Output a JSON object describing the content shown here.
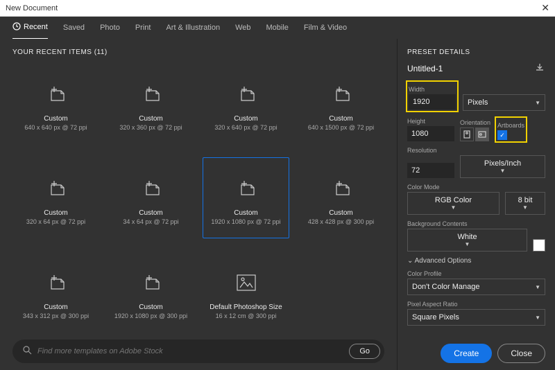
{
  "title": "New Document",
  "tabs": [
    "Recent",
    "Saved",
    "Photo",
    "Print",
    "Art & Illustration",
    "Web",
    "Mobile",
    "Film & Video"
  ],
  "recent_head": "YOUR RECENT ITEMS",
  "recent_count": "(11)",
  "items": [
    {
      "label": "Custom",
      "sub": "640 x 640 px @ 72 ppi"
    },
    {
      "label": "Custom",
      "sub": "320 x 360 px @ 72 ppi"
    },
    {
      "label": "Custom",
      "sub": "320 x 640 px @ 72 ppi"
    },
    {
      "label": "Custom",
      "sub": "640 x 1500 px @ 72 ppi"
    },
    {
      "label": "Custom",
      "sub": "320 x 64 px @ 72 ppi"
    },
    {
      "label": "Custom",
      "sub": "34 x 64 px @ 72 ppi"
    },
    {
      "label": "Custom",
      "sub": "1920 x 1080 px @ 72 ppi"
    },
    {
      "label": "Custom",
      "sub": "428 x 428 px @ 300 ppi"
    },
    {
      "label": "Custom",
      "sub": "343 x 312 px @ 300 ppi"
    },
    {
      "label": "Custom",
      "sub": "1920 x 1080 px @ 300 ppi"
    },
    {
      "label": "Default Photoshop Size",
      "sub": "16 x 12 cm @ 300 ppi"
    }
  ],
  "search": {
    "placeholder": "Find more templates on Adobe Stock",
    "go": "Go"
  },
  "preset": {
    "head": "PRESET DETAILS",
    "name": "Untitled-1",
    "width_lbl": "Width",
    "width": "1920",
    "unit": "Pixels",
    "height_lbl": "Height",
    "height": "1080",
    "orient_lbl": "Orientation",
    "artboards_lbl": "Artboards",
    "res_lbl": "Resolution",
    "res": "72",
    "res_unit": "Pixels/Inch",
    "mode_lbl": "Color Mode",
    "mode": "RGB Color",
    "bit": "8 bit",
    "bg_lbl": "Background Contents",
    "bg": "White",
    "adv": "Advanced Options",
    "profile_lbl": "Color Profile",
    "profile": "Don't Color Manage",
    "par_lbl": "Pixel Aspect Ratio",
    "par": "Square Pixels"
  },
  "buttons": {
    "create": "Create",
    "close": "Close"
  }
}
